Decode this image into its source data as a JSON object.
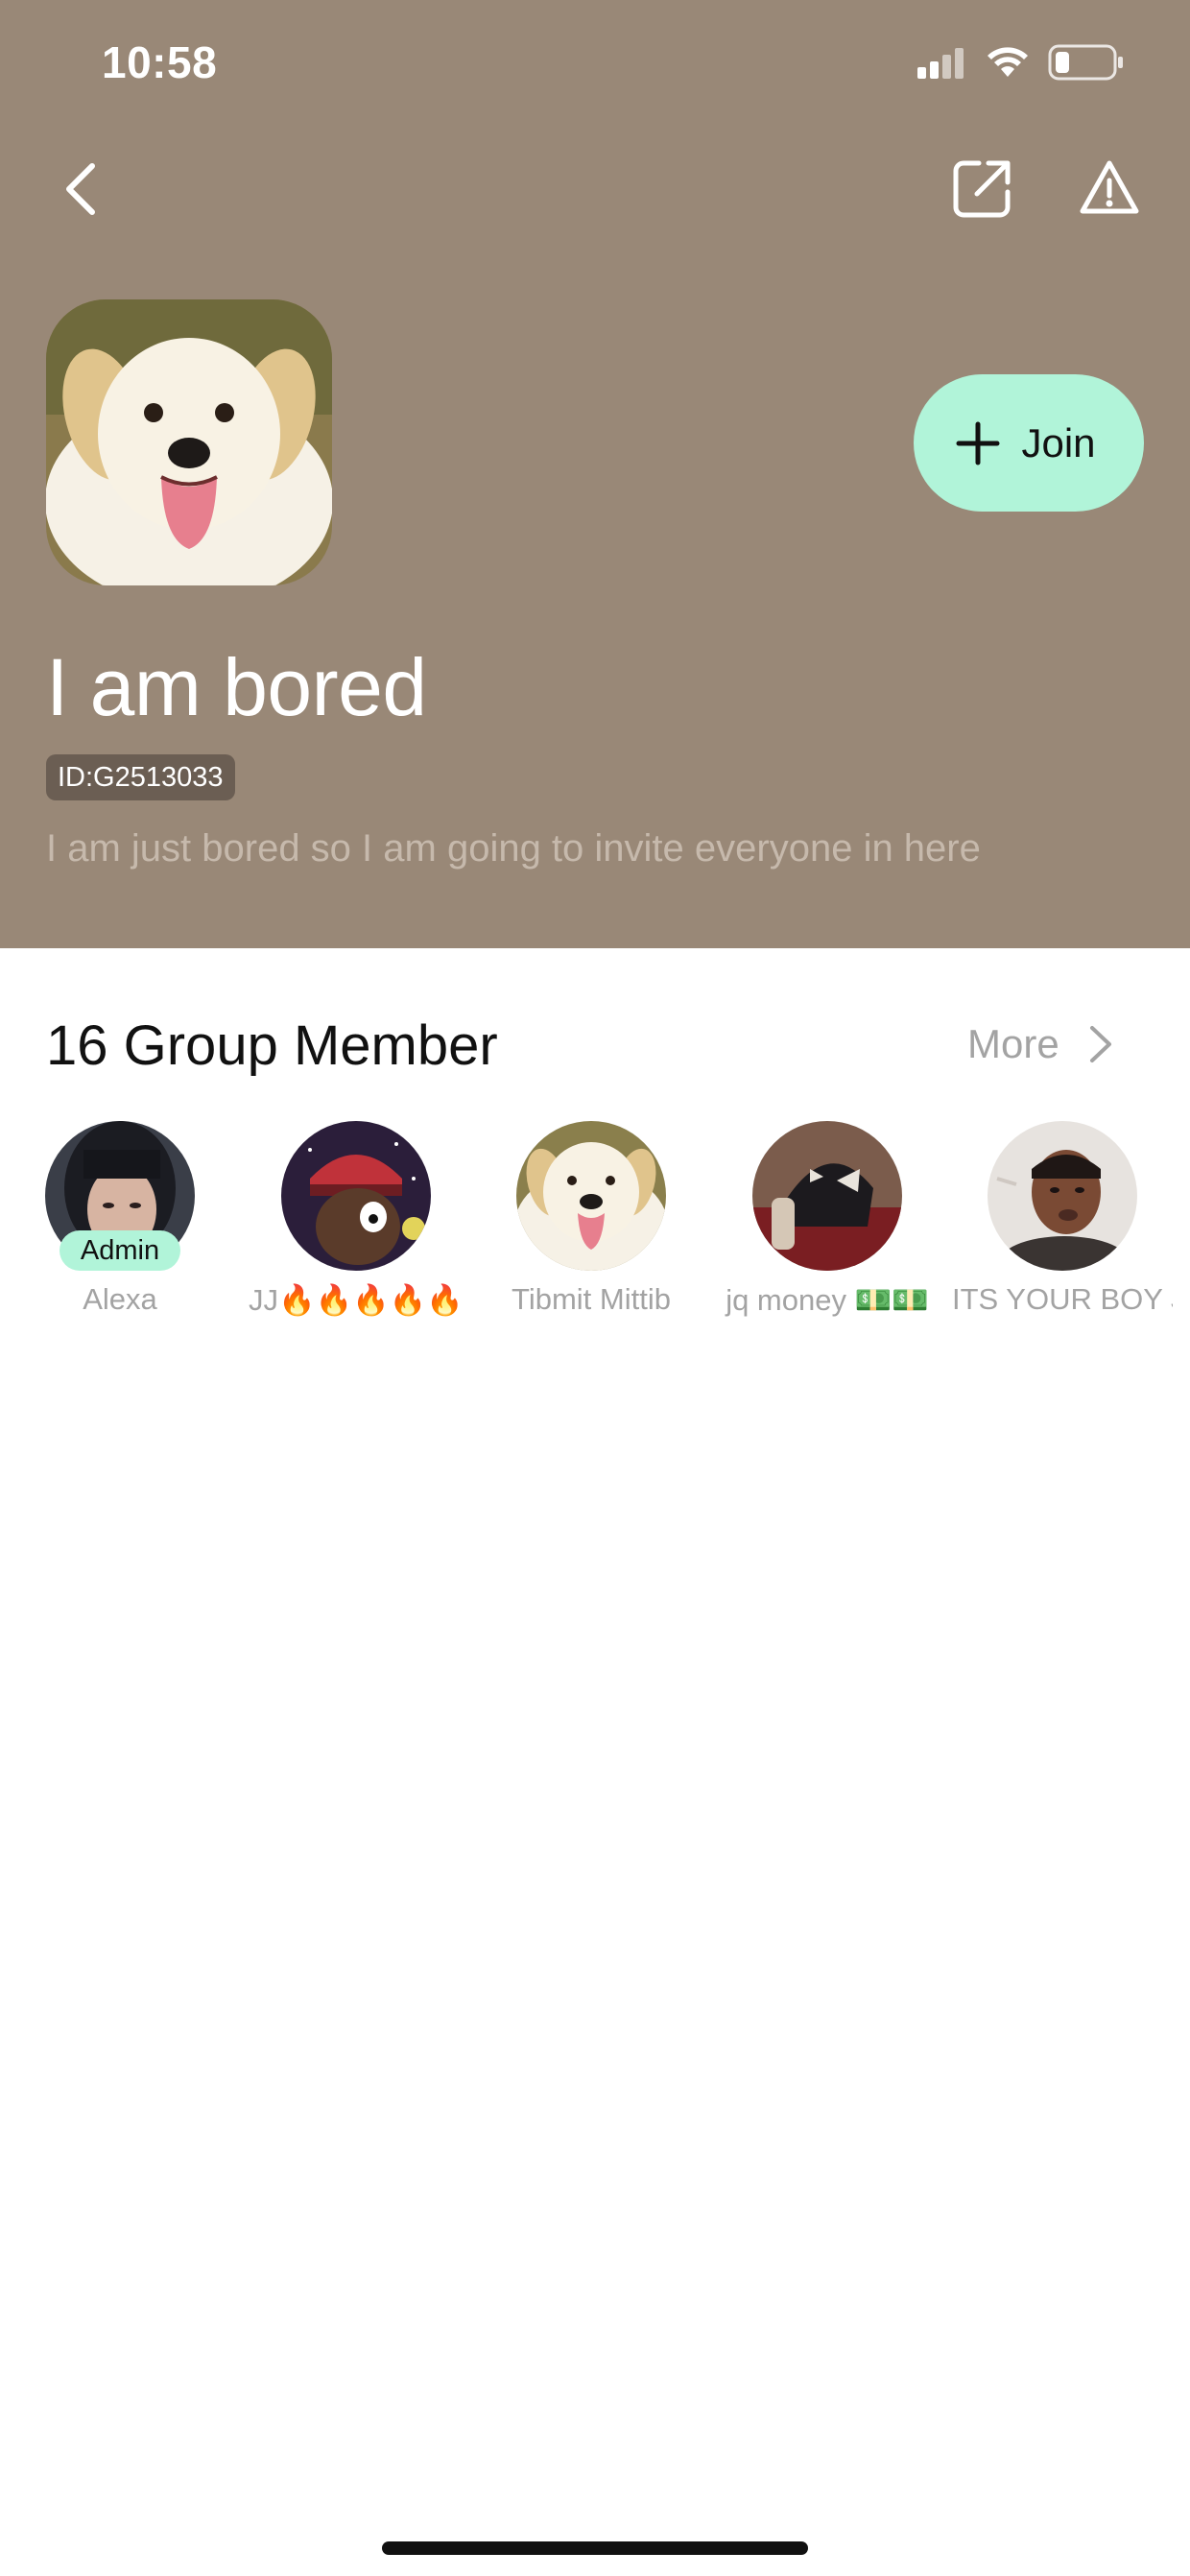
{
  "status_bar": {
    "time": "10:58"
  },
  "group": {
    "name": "I am bored",
    "id": "ID:G2513033",
    "description": "I am just bored so I am going to invite everyone in here",
    "join_label": "Join"
  },
  "members": {
    "title": "16 Group Member",
    "more_label": "More",
    "admin_label": "Admin",
    "items": [
      {
        "name": "Alexa"
      },
      {
        "name": "JJ🔥🔥🔥🔥🔥"
      },
      {
        "name": "Tibmit Mittib"
      },
      {
        "name": "jq money 💵💵"
      },
      {
        "name": "ITS YOUR BOY J..."
      }
    ]
  },
  "colors": {
    "header_bg": "#998877",
    "accent": "#b1f4d9",
    "id_badge": "#6b5e53",
    "muted_text": "#a3a3a3"
  },
  "icons": [
    "back-icon",
    "share-icon",
    "warning-icon",
    "plus-icon",
    "chevron-right-icon",
    "signal-icon",
    "wifi-icon",
    "battery-icon"
  ]
}
